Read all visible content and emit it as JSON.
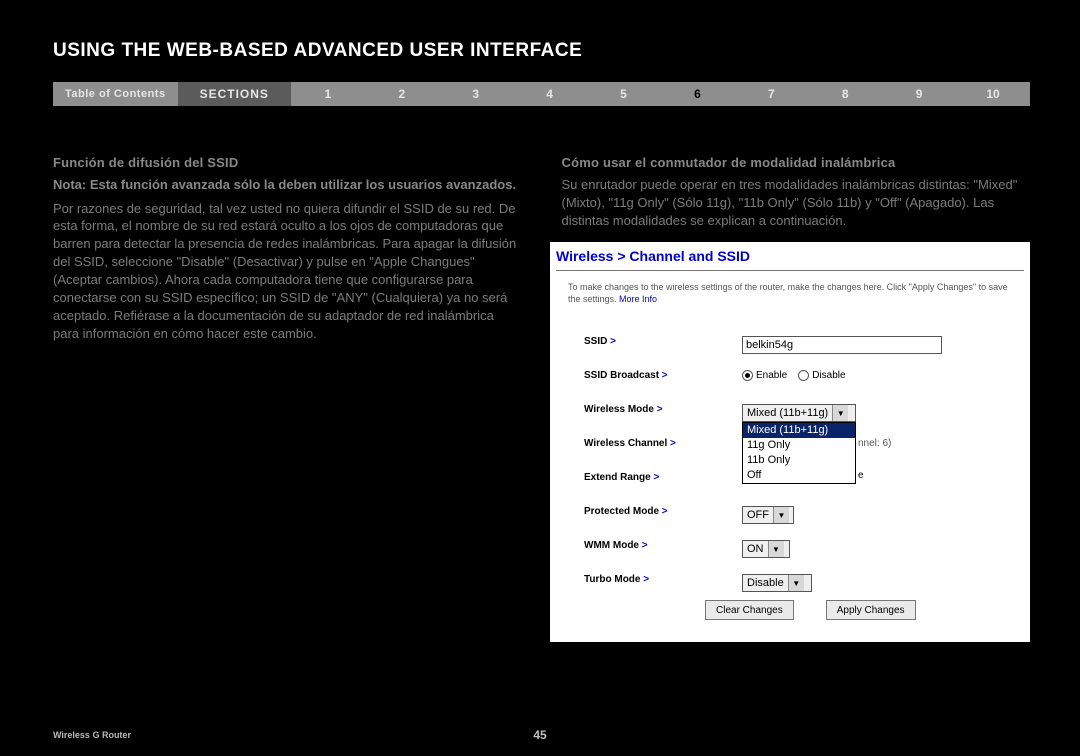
{
  "header": {
    "title": "USING THE WEB-BASED ADVANCED USER INTERFACE"
  },
  "nav": {
    "toc": "Table of Contents",
    "sections_label": "SECTIONS",
    "items": [
      "1",
      "2",
      "3",
      "4",
      "5",
      "6",
      "7",
      "8",
      "9",
      "10"
    ],
    "active_index": 5
  },
  "left": {
    "heading": "Función de difusión del SSID",
    "note": "Nota: Esta función avanzada sólo la deben utilizar los usuarios avanzados.",
    "para": "Por razones de seguridad, tal vez usted no quiera difundir el SSID de su red. De esta forma, el nombre de su red estará oculto a los ojos de computadoras que barren para detectar la presencia de redes inalámbricas. Para apagar la difusión del SSID, seleccione \"Disable\" (Desactivar) y pulse en \"Apple Changues\" (Aceptar cambios). Ahora cada computadora tiene que configurarse para conectarse con su SSID específico; un SSID de \"ANY\" (Cualquiera) ya no será aceptado. Refiérase a la documentación de su adaptador de red inalámbrica para información en cómo hacer este cambio."
  },
  "right": {
    "heading": "Cómo usar el conmutador de modalidad inalámbrica",
    "para": "Su enrutador puede operar en tres modalidades inalámbricas distintas: \"Mixed\" (Mixto), \"11g Only\" (Sólo 11g), \"11b Only\" (Sólo 11b) y \"Off\" (Apagado). Las distintas modalidades se explican a continuación."
  },
  "panel": {
    "title": "Wireless > Channel and SSID",
    "intro_a": "To make changes to the wireless settings of the router, make the changes here. Click \"Apply Changes\" to save the settings. ",
    "intro_more": "More Info",
    "rows": {
      "ssid": {
        "label": "SSID",
        "value": "belkin54g"
      },
      "broadcast": {
        "label": "SSID Broadcast",
        "enable": "Enable",
        "disable": "Disable",
        "selected": "enable"
      },
      "mode": {
        "label": "Wireless Mode",
        "selected": "Mixed (11b+11g)",
        "options": [
          "Mixed (11b+11g)",
          "11g Only",
          "11b Only",
          "Off"
        ]
      },
      "channel": {
        "label": "Wireless Channel",
        "hint": "nnel: 6)"
      },
      "extend": {
        "label": "Extend Range"
      },
      "protected": {
        "label": "Protected Mode",
        "value": "OFF"
      },
      "wmm": {
        "label": "WMM Mode",
        "value": "ON"
      },
      "turbo": {
        "label": "Turbo Mode",
        "value": "Disable"
      }
    },
    "arrow": " >",
    "buttons": {
      "clear": "Clear Changes",
      "apply": "Apply Changes"
    }
  },
  "footer": {
    "product": "Wireless G Router",
    "page": "45"
  }
}
